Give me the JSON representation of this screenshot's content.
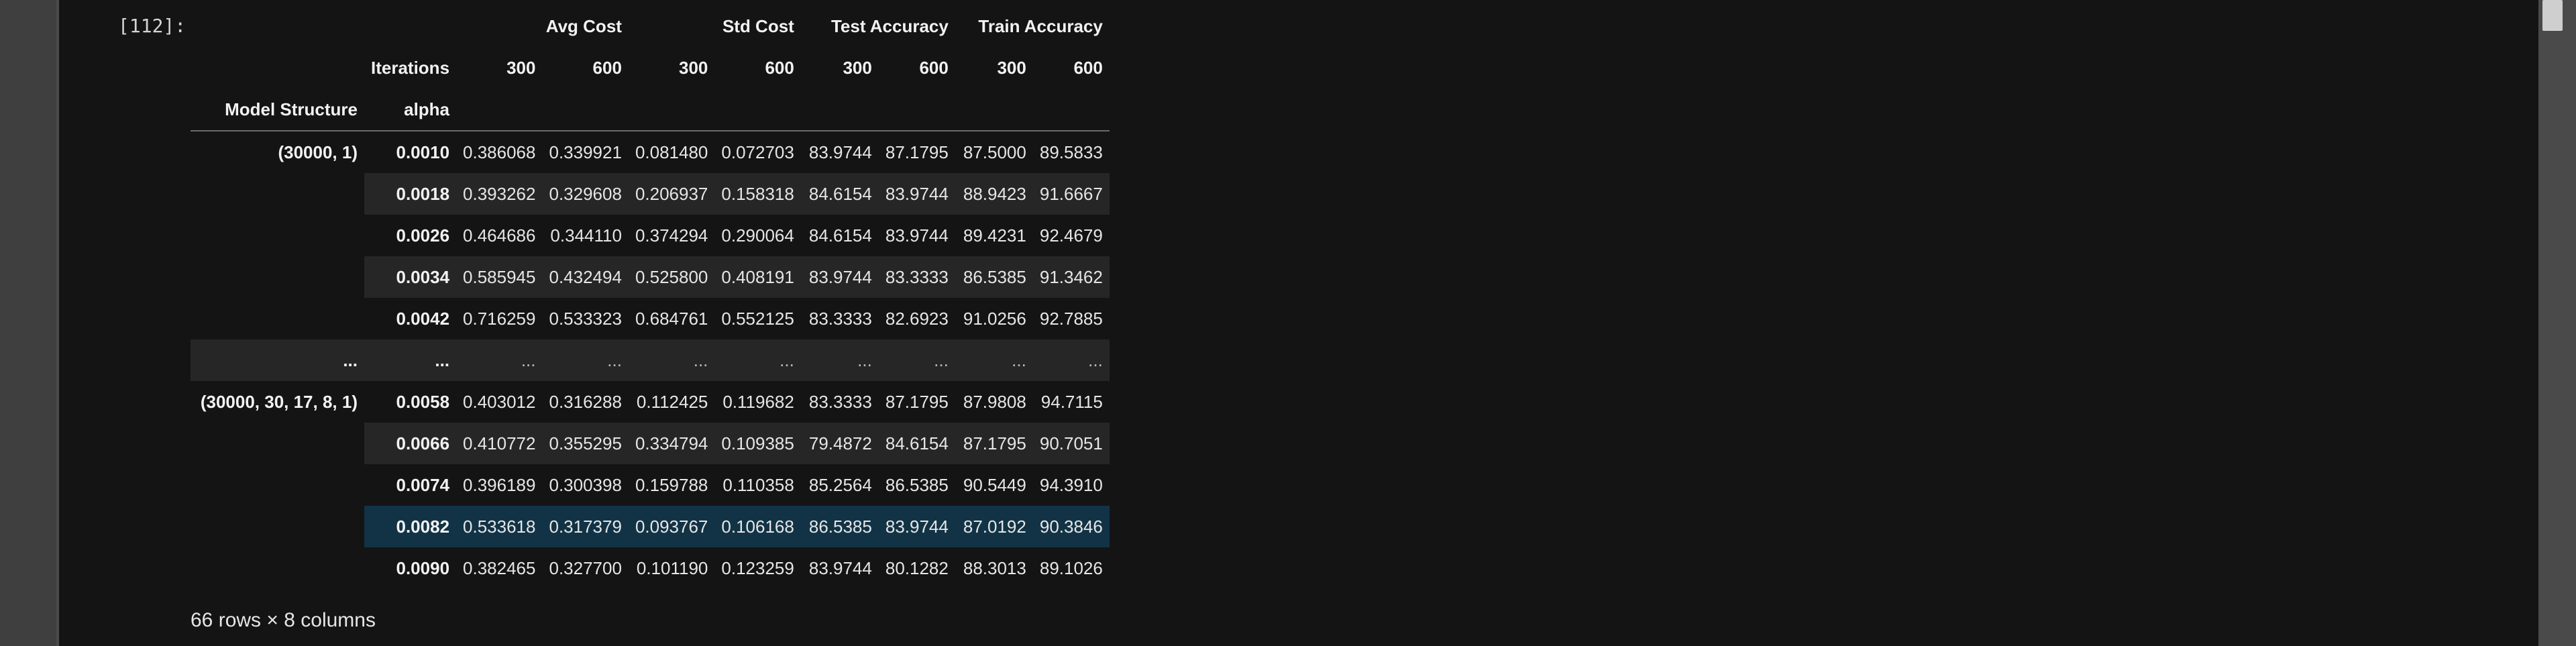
{
  "cell": {
    "execution_count": "[112]:"
  },
  "dataframe": {
    "column_groups": [
      "Avg Cost",
      "Std Cost",
      "Test Accuracy",
      "Train Accuracy"
    ],
    "columns_name": "Iterations",
    "iteration_labels": [
      "300",
      "600",
      "300",
      "600",
      "300",
      "600",
      "300",
      "600"
    ],
    "index_names": [
      "Model Structure",
      "alpha"
    ],
    "rows": [
      {
        "model": "(30000, 1)",
        "alpha": "0.0010",
        "values": [
          "0.386068",
          "0.339921",
          "0.081480",
          "0.072703",
          "83.9744",
          "87.1795",
          "87.5000",
          "89.5833"
        ]
      },
      {
        "model": "",
        "alpha": "0.0018",
        "values": [
          "0.393262",
          "0.329608",
          "0.206937",
          "0.158318",
          "84.6154",
          "83.9744",
          "88.9423",
          "91.6667"
        ]
      },
      {
        "model": "",
        "alpha": "0.0026",
        "values": [
          "0.464686",
          "0.344110",
          "0.374294",
          "0.290064",
          "84.6154",
          "83.9744",
          "89.4231",
          "92.4679"
        ]
      },
      {
        "model": "",
        "alpha": "0.0034",
        "values": [
          "0.585945",
          "0.432494",
          "0.525800",
          "0.408191",
          "83.9744",
          "83.3333",
          "86.5385",
          "91.3462"
        ]
      },
      {
        "model": "",
        "alpha": "0.0042",
        "values": [
          "0.716259",
          "0.533323",
          "0.684761",
          "0.552125",
          "83.3333",
          "82.6923",
          "91.0256",
          "92.7885"
        ]
      },
      {
        "model": "...",
        "alpha": "...",
        "values": [
          "...",
          "...",
          "...",
          "...",
          "...",
          "...",
          "...",
          "..."
        ]
      },
      {
        "model": "(30000, 30, 17, 8, 1)",
        "alpha": "0.0058",
        "values": [
          "0.403012",
          "0.316288",
          "0.112425",
          "0.119682",
          "83.3333",
          "87.1795",
          "87.9808",
          "94.7115"
        ]
      },
      {
        "model": "",
        "alpha": "0.0066",
        "values": [
          "0.410772",
          "0.355295",
          "0.334794",
          "0.109385",
          "79.4872",
          "84.6154",
          "87.1795",
          "90.7051"
        ]
      },
      {
        "model": "",
        "alpha": "0.0074",
        "values": [
          "0.396189",
          "0.300398",
          "0.159788",
          "0.110358",
          "85.2564",
          "86.5385",
          "90.5449",
          "94.3910"
        ]
      },
      {
        "model": "",
        "alpha": "0.0082",
        "values": [
          "0.533618",
          "0.317379",
          "0.093767",
          "0.106168",
          "86.5385",
          "83.9744",
          "87.0192",
          "90.3846"
        ]
      },
      {
        "model": "",
        "alpha": "0.0090",
        "values": [
          "0.382465",
          "0.327700",
          "0.101190",
          "0.123259",
          "83.9744",
          "80.1282",
          "88.3013",
          "89.1026"
        ]
      }
    ],
    "summary": "66 rows × 8 columns"
  },
  "colors": {
    "background": "#141414",
    "stripe": "#262626",
    "highlight": "#123346",
    "text": "#e6e6e6"
  }
}
